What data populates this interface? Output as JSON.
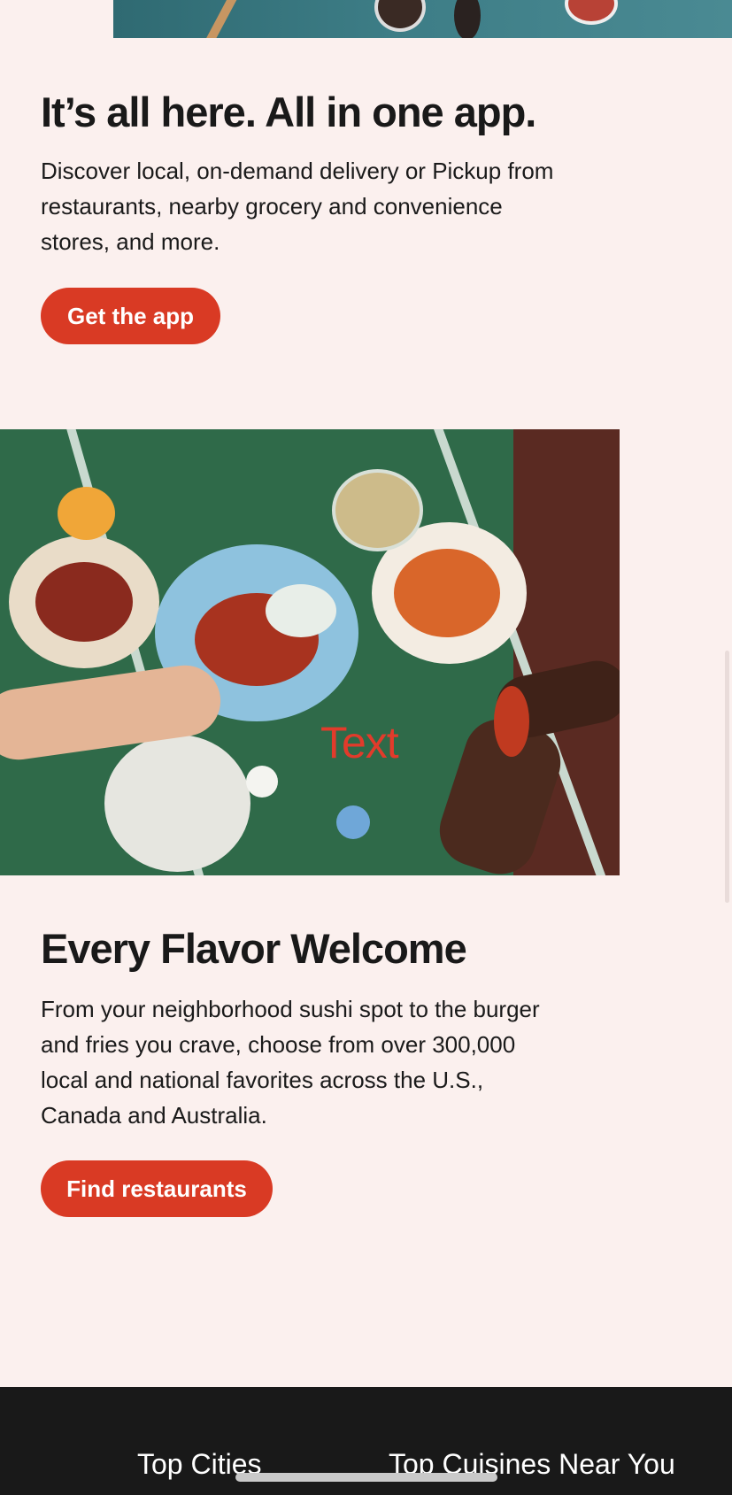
{
  "app_section": {
    "title": "It’s all here. All in one app.",
    "description": "Discover local, on-demand delivery or Pickup from restaurants, nearby grocery and convenience stores, and more.",
    "button_label": "Get the app"
  },
  "flavor_section": {
    "image_overlay_text": "Text",
    "title": "Every Flavor Welcome",
    "description": "From your neighborhood sushi spot to the burger and fries you crave, choose from over 300,000 local and national favorites across the U.S., Canada and Australia.",
    "button_label": "Find restaurants"
  },
  "footer": {
    "top_cities_label": "Top Cities",
    "top_cuisines_label": "Top Cuisines Near You"
  },
  "colors": {
    "background": "#fbf0ee",
    "accent": "#d93a24",
    "footer": "#191919"
  }
}
